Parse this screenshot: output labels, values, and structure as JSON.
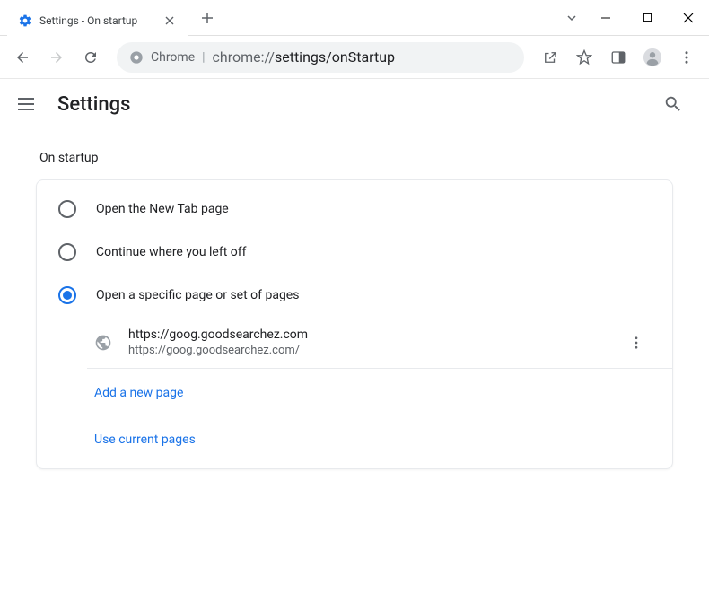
{
  "tab": {
    "title": "Settings - On startup"
  },
  "omnibox": {
    "prefix": "Chrome",
    "url_gray": "chrome://",
    "url_main": "settings/onStartup"
  },
  "settings": {
    "header_title": "Settings",
    "section_title": "On startup",
    "options": [
      {
        "label": "Open the New Tab page",
        "selected": false
      },
      {
        "label": "Continue where you left off",
        "selected": false
      },
      {
        "label": "Open a specific page or set of pages",
        "selected": true
      }
    ],
    "pages": [
      {
        "title": "https://goog.goodsearchez.com",
        "url": "https://goog.goodsearchez.com/"
      }
    ],
    "add_page_label": "Add a new page",
    "use_current_label": "Use current pages"
  }
}
